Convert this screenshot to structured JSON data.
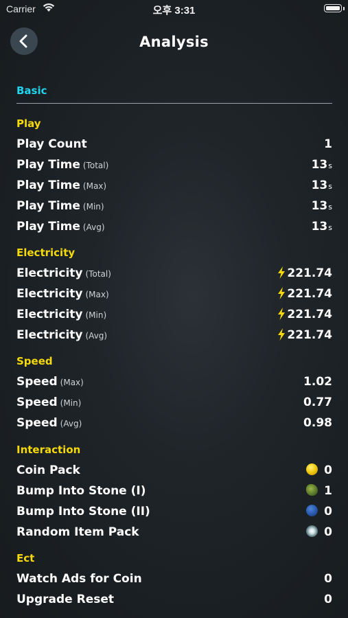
{
  "status_bar": {
    "carrier": "Carrier",
    "time": "오후 3:31"
  },
  "header": {
    "title": "Analysis"
  },
  "section": {
    "title": "Basic"
  },
  "groups": {
    "play": {
      "title": "Play",
      "rows": [
        {
          "label": "Play Count",
          "sub": "",
          "value": "1",
          "unit": ""
        },
        {
          "label": "Play Time",
          "sub": "(Total)",
          "value": "13",
          "unit": "s"
        },
        {
          "label": "Play Time",
          "sub": "(Max)",
          "value": "13",
          "unit": "s"
        },
        {
          "label": "Play Time",
          "sub": "(Min)",
          "value": "13",
          "unit": "s"
        },
        {
          "label": "Play Time",
          "sub": "(Avg)",
          "value": "13",
          "unit": "s"
        }
      ]
    },
    "electricity": {
      "title": "Electricity",
      "rows": [
        {
          "label": "Electricity",
          "sub": "(Total)",
          "value": "221.74"
        },
        {
          "label": "Electricity",
          "sub": "(Max)",
          "value": "221.74"
        },
        {
          "label": "Electricity",
          "sub": "(Min)",
          "value": "221.74"
        },
        {
          "label": "Electricity",
          "sub": "(Avg)",
          "value": "221.74"
        }
      ]
    },
    "speed": {
      "title": "Speed",
      "rows": [
        {
          "label": "Speed",
          "sub": "(Max)",
          "value": "1.02"
        },
        {
          "label": "Speed",
          "sub": "(Min)",
          "value": "0.77"
        },
        {
          "label": "Speed",
          "sub": "(Avg)",
          "value": "0.98"
        }
      ]
    },
    "interaction": {
      "title": "Interaction",
      "rows": [
        {
          "label": "Coin Pack",
          "value": "0",
          "icon": "coin-icon"
        },
        {
          "label": "Bump Into Stone (I)",
          "value": "1",
          "icon": "green-stone-icon"
        },
        {
          "label": "Bump Into Stone (II)",
          "value": "0",
          "icon": "blue-stone-icon"
        },
        {
          "label": "Random Item Pack",
          "value": "0",
          "icon": "item-pack-icon"
        }
      ]
    },
    "ect": {
      "title": "Ect",
      "rows": [
        {
          "label": "Watch Ads for Coin",
          "value": "0"
        },
        {
          "label": "Upgrade Reset",
          "value": "0"
        }
      ]
    }
  },
  "colors": {
    "section_accent": "#22d3ee",
    "group_accent": "#f5d90a",
    "bolt": "#f5d90a"
  }
}
